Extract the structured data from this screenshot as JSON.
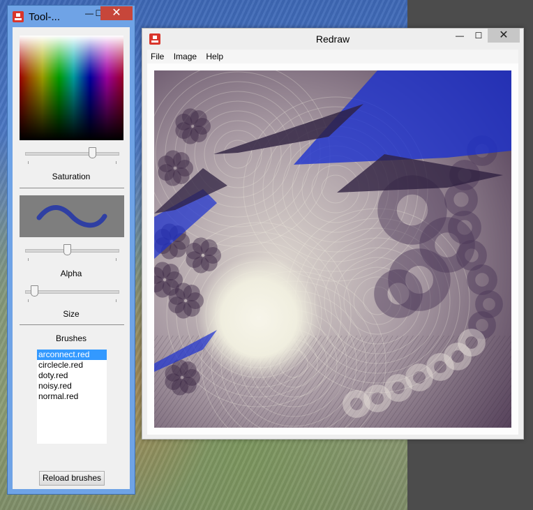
{
  "tool_window": {
    "title": "Tool-...",
    "saturation_label": "Saturation",
    "alpha_label": "Alpha",
    "size_label": "Size",
    "brushes_label": "Brushes",
    "brushes": [
      {
        "label": "arconnect.red",
        "selected": true
      },
      {
        "label": "circlecle.red",
        "selected": false
      },
      {
        "label": "doty.red",
        "selected": false
      },
      {
        "label": "noisy.red",
        "selected": false
      },
      {
        "label": "normal.red",
        "selected": false
      }
    ],
    "reload_label": "Reload brushes",
    "saturation_value": 0.72,
    "alpha_value": 0.44,
    "size_value": 0.06,
    "brush_color": "#2f3fa3",
    "close_glyph": "✕",
    "max_glyph": "☐",
    "min_glyph": "—"
  },
  "redraw_window": {
    "title": "Redraw",
    "menu": [
      "File",
      "Image",
      "Help"
    ],
    "close_glyph": "✕",
    "max_glyph": "☐",
    "min_glyph": "—"
  },
  "colors": {
    "accent_blue": "#1a2fd0",
    "canvas_bg": "#a5909a",
    "light_glow": "#f2f0e4",
    "dark_purple": "#3b2745",
    "selection": "#3399ff"
  }
}
